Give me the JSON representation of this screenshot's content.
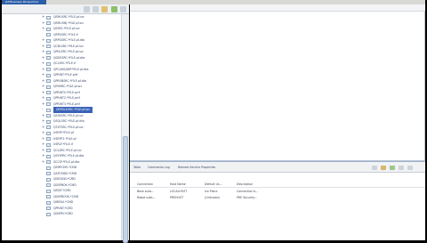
{
  "titlebar": {
    "label": "JSF/Business Perspective"
  },
  "navigator": {
    "items": [
      {
        "label": "QEMUSRC.*FILE.pf-src",
        "expander": "+",
        "selected": false
      },
      {
        "label": "QEMUOBJ.*FILE.pf-src",
        "expander": "+",
        "selected": false
      },
      {
        "label": "QESRC.*FILE.pf-src",
        "expander": "+",
        "selected": false
      },
      {
        "label": "QRPGSRC.*FILE.lf",
        "expander": "",
        "selected": false
      },
      {
        "label": "QRPGSRC.*FILE.pf-dta",
        "expander": "+",
        "selected": false
      },
      {
        "label": "QCBLSRC.*FILE.pf-src",
        "expander": "+",
        "selected": false
      },
      {
        "label": "QPNLSRC.*FILE.pf-src",
        "expander": "+",
        "selected": false
      },
      {
        "label": "QDDSSRC.*FILE.pf-dta",
        "expander": "+",
        "selected": false
      },
      {
        "label": "QCLSRC.*FILE.lf",
        "expander": "+",
        "selected": false
      },
      {
        "label": "QPCLIBSAMP.*FILE.pf-dta",
        "expander": "+",
        "selected": false
      },
      {
        "label": "QPRINT.*FILE.prtf",
        "expander": "+",
        "selected": false
      },
      {
        "label": "QPROBSRC.*FILE.pf-dta",
        "expander": "+",
        "selected": false
      },
      {
        "label": "QFMSRC.*FILE.pf-src",
        "expander": "+",
        "selected": false
      },
      {
        "label": "QPRINTS.*FILE.prtf",
        "expander": "+",
        "selected": false
      },
      {
        "label": "QPRINT2.*FILE.prtf",
        "expander": "+",
        "selected": false
      },
      {
        "label": "QPRINT3.*FILE.prtf",
        "expander": "+",
        "selected": false
      },
      {
        "label": "QRPGLESRC.*FILE.pf-src",
        "expander": "-",
        "selected": true
      },
      {
        "label": "QS36SRC.*FILE.pf-src",
        "expander": "+",
        "selected": false
      },
      {
        "label": "QSQLSRC.*FILE.pf-dta",
        "expander": "+",
        "selected": false
      },
      {
        "label": "QTXTSRC.*FILE.pf-src",
        "expander": "+",
        "selected": false
      },
      {
        "label": "USRPF.*FILE.pf",
        "expander": "+",
        "selected": false
      },
      {
        "label": "USRPF2.*FILE.pf",
        "expander": "+",
        "selected": false
      },
      {
        "label": "USRLF.*FILE.lf",
        "expander": "+",
        "selected": false
      },
      {
        "label": "QCLSRC.*FILE.pf-src",
        "expander": "+",
        "selected": false
      },
      {
        "label": "QSYSPRC.*FILE.pf-dta",
        "expander": "+",
        "selected": false
      },
      {
        "label": "SCCSF.*FILE.pf-dta",
        "expander": "+",
        "selected": false
      },
      {
        "label": "QEMPCMS.*CMD",
        "expander": "",
        "selected": false
      },
      {
        "label": "QAPCMDS.*CMD",
        "expander": "",
        "selected": false
      },
      {
        "label": "QDESIGN.*CMD",
        "expander": "",
        "selected": false
      },
      {
        "label": "QDSPBOK.*CMD",
        "expander": "",
        "selected": false
      },
      {
        "label": "QEDIT.*CMD",
        "expander": "",
        "selected": false
      },
      {
        "label": "QDSPBOOK.*CMD",
        "expander": "",
        "selected": false
      },
      {
        "label": "QMENU.*CMD",
        "expander": "",
        "selected": false
      },
      {
        "label": "QPRINT.*CMD",
        "expander": "",
        "selected": false
      },
      {
        "label": "QDSPM.*CMD",
        "expander": "",
        "selected": false
      }
    ]
  },
  "views": {
    "tabs": [
      "Table",
      "Commands Log",
      "Remote Service Properties"
    ],
    "table": {
      "headers": [
        "Connection",
        "Host Name",
        "Default Us...",
        "Description"
      ],
      "rows": [
        [
          "Base subs...",
          "LOCALHOST",
          "Ice Plane",
          "Connection b..."
        ],
        [
          "Robot subs...",
          "PREHOST",
          "(Unknown)",
          "PRE Security..."
        ]
      ]
    }
  },
  "colors": {
    "accent": "#2d5ea8",
    "selection": "#3a63b8",
    "panel_border": "#9ab0cc"
  }
}
